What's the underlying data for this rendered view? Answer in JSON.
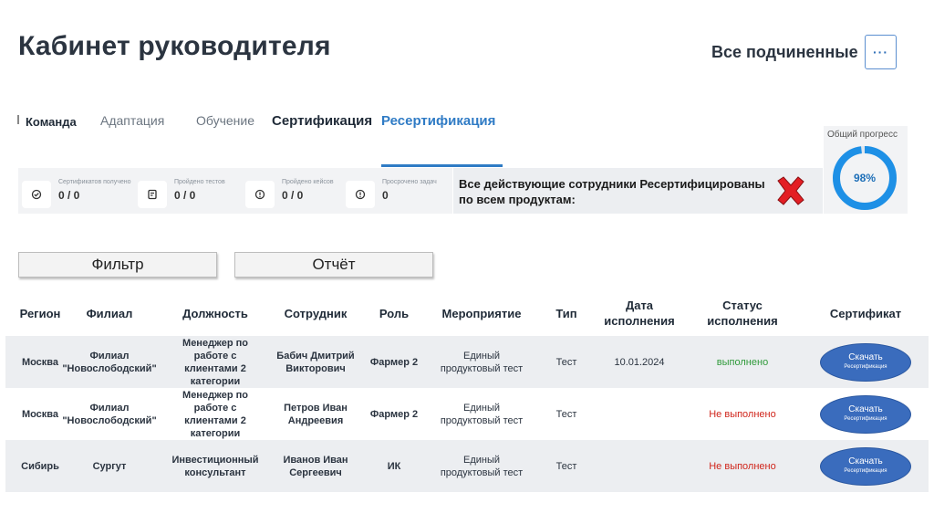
{
  "header": {
    "title": "Кабинет руководителя",
    "subordinates": "Все подчиненные",
    "more": "···"
  },
  "tabs": [
    "Команда",
    "Адаптация",
    "Обучение",
    "Сертификация",
    "Ресертификация"
  ],
  "active_tab": "Ресертификация",
  "stats": [
    {
      "label": "Сертификатов получено",
      "value": "0 / 0",
      "icon": "check-shield-icon"
    },
    {
      "label": "Пройдено тестов",
      "value": "0 / 0",
      "icon": "test-icon"
    },
    {
      "label": "Пройдено кейсов",
      "value": "0 / 0",
      "icon": "info-icon"
    },
    {
      "label": "Просрочено задач",
      "value": "0",
      "icon": "info-icon"
    }
  ],
  "notice": "Все действующие сотрудники Ресертифицированы по всем продуктам:",
  "progress": {
    "label": "Общий прогресс",
    "value": "98%",
    "fraction": 0.98
  },
  "buttons": {
    "filter": "Фильтр",
    "report": "Отчёт"
  },
  "columns": [
    "Регион",
    "Филиал",
    "Должность",
    "Сотрудник",
    "Роль",
    "Мероприятие",
    "Тип",
    "Дата исполнения",
    "Статус исполнения",
    "Сертификат"
  ],
  "rows": [
    {
      "region": "Москва",
      "branch": "Филиал \"Новослободский\"",
      "position": "Менеджер по работе с клиентами 2 категории",
      "employee": "Бабич Дмитрий Викторович",
      "role": "Фармер 2",
      "event": "Единый продуктовый тест",
      "type": "Тест",
      "date": "10.01.2024",
      "status": "выполнено",
      "status_color": "#2f9a3a",
      "cert_label": "Скачать",
      "cert_sub": "Ресертификация"
    },
    {
      "region": "Москва",
      "branch": "Филиал \"Новослободский\"",
      "position": "Менеджер по работе с клиентами 2 категории",
      "employee": "Петров Иван Андреевия",
      "role": "Фармер 2",
      "event": "Единый продуктовый тест",
      "type": "Тест",
      "date": "",
      "status": "Не выполнено",
      "status_color": "#d0261c",
      "cert_label": "Скачать",
      "cert_sub": "Ресертификация"
    },
    {
      "region": "Сибирь",
      "branch": "Сургут",
      "position": "Инвестиционный консультант",
      "employee": "Иванов Иван Сергеевич",
      "role": "ИК",
      "event": "Единый продуктовый тест",
      "type": "Тест",
      "date": "",
      "status": "Не выполнено",
      "status_color": "#d0261c",
      "cert_label": "Скачать",
      "cert_sub": "Ресертификация"
    }
  ]
}
